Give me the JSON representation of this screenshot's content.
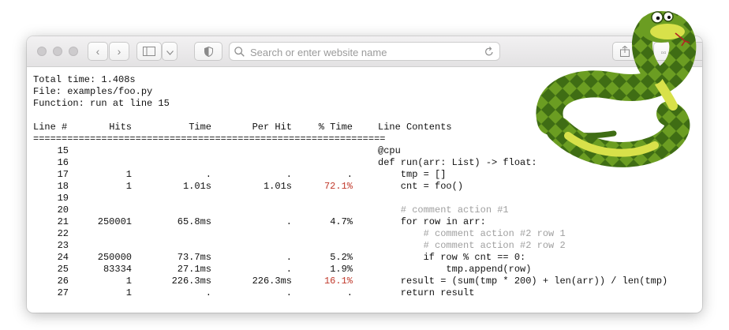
{
  "browser": {
    "search_placeholder": "Search or enter website name",
    "icons": [
      "back-icon",
      "forward-icon",
      "sidebar-icon",
      "chevron-down-icon",
      "shield-icon",
      "search-icon",
      "reload-icon",
      "share-icon",
      "tabs-icon",
      "plus-icon"
    ]
  },
  "report": {
    "total_time": "Total time: 1.408s",
    "file": "File: examples/foo.py",
    "function": "Function: run at line 15",
    "headers": {
      "line": "Line #",
      "hits": "Hits",
      "time": "Time",
      "per_hit": "Per Hit",
      "pct_time": "% Time",
      "contents": "Line Contents"
    },
    "rule": "==============================================================",
    "rows": [
      {
        "line": "15",
        "hits": "",
        "time": "",
        "per_hit": "",
        "pct": "",
        "code": "@cpu",
        "comment": false
      },
      {
        "line": "16",
        "hits": "",
        "time": "",
        "per_hit": "",
        "pct": "",
        "code": "def run(arr: List) -> float:",
        "comment": false
      },
      {
        "line": "17",
        "hits": "1",
        "time": ".",
        "per_hit": ".",
        "pct": ".",
        "code": "    tmp = []",
        "comment": false
      },
      {
        "line": "18",
        "hits": "1",
        "time": "1.01s",
        "per_hit": "1.01s",
        "pct": "72.1%",
        "code": "    cnt = foo()",
        "comment": false,
        "hot": true
      },
      {
        "line": "19",
        "hits": "",
        "time": "",
        "per_hit": "",
        "pct": "",
        "code": "",
        "comment": false
      },
      {
        "line": "20",
        "hits": "",
        "time": "",
        "per_hit": "",
        "pct": "",
        "code": "    # comment action #1",
        "comment": true
      },
      {
        "line": "21",
        "hits": "250001",
        "time": "65.8ms",
        "per_hit": ".",
        "pct": "4.7%",
        "code": "    for row in arr:",
        "comment": false
      },
      {
        "line": "22",
        "hits": "",
        "time": "",
        "per_hit": "",
        "pct": "",
        "code": "        # comment action #2 row 1",
        "comment": true
      },
      {
        "line": "23",
        "hits": "",
        "time": "",
        "per_hit": "",
        "pct": "",
        "code": "        # comment action #2 row 2",
        "comment": true
      },
      {
        "line": "24",
        "hits": "250000",
        "time": "73.7ms",
        "per_hit": ".",
        "pct": "5.2%",
        "code": "        if row % cnt == 0:",
        "comment": false
      },
      {
        "line": "25",
        "hits": "83334",
        "time": "27.1ms",
        "per_hit": ".",
        "pct": "1.9%",
        "code": "            tmp.append(row)",
        "comment": false
      },
      {
        "line": "26",
        "hits": "1",
        "time": "226.3ms",
        "per_hit": "226.3ms",
        "pct": "16.1%",
        "code": "    result = (sum(tmp * 200) + len(arr)) / len(tmp)",
        "comment": false,
        "hot": true
      },
      {
        "line": "27",
        "hits": "1",
        "time": ".",
        "per_hit": ".",
        "pct": ".",
        "code": "    return result",
        "comment": false
      }
    ]
  },
  "colors": {
    "hot": "#c0392b",
    "comment": "#a0a0a0",
    "snake_green": "#5a8f1e",
    "snake_yellow": "#d8e14a"
  }
}
